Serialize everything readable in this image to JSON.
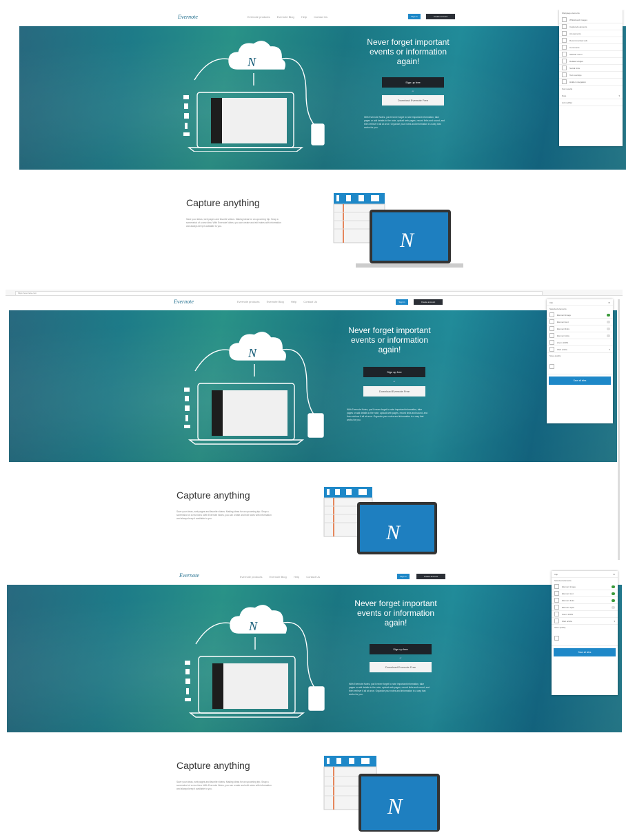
{
  "site": {
    "logo": "Evernote",
    "nav_links": [
      "Evernote products",
      "Evernote Blog",
      "Help",
      "Contact Us"
    ],
    "sign_in": "Sign in",
    "create_account": "Create account"
  },
  "hero": {
    "title": "Never forget important events or information again!",
    "signup_button": "Sign up free",
    "or": "or",
    "download_button": "Download Evernote Free",
    "description": "With Evernote Notes, you’ll never forget to note important information, take pages or add details to the note, upload web pages, record links and sound, and then retrieve it all at once. Organize your notes and information in a way that works for you."
  },
  "capture": {
    "title": "Capture anything",
    "description": "Save your ideas, web pages and favorite videos. Making ideas for an upcoming trip. Snap a screenshot of a new idea. With Evernote Notes, you can create and edit notes with information and always keep it available to you."
  },
  "browser": {
    "url": "https://evernote.com"
  },
  "panel1": {
    "header": "Webpage elements",
    "items": [
      "Whiteboard images",
      "Captured elements",
      "Ad elements",
      "Recommended ads",
      "Comments",
      "Sidebar menu",
      "Related widget",
      "Social links",
      "Text overlays",
      "Hidden navigation"
    ],
    "select_label": "Sort results",
    "select_value": "Date",
    "footer": "Ad modifier"
  },
  "panel2": {
    "header": "Clip",
    "section": "Selected elements",
    "items": [
      "Element image",
      "Element text",
      "Element links",
      "Element style"
    ],
    "zoom_label": "Zoom 100%",
    "select_value": "Web article",
    "quality_label": "Save quality",
    "action": "Save all sites"
  },
  "panel3": {
    "header": "Clip",
    "section": "Selected elements",
    "items": [
      "Element image",
      "Element text",
      "Element links",
      "Element style"
    ],
    "zoom_label": "Zoom 100%",
    "select_value": "Web article",
    "quality_label": "Save quality",
    "action": "Save all sites"
  },
  "colors": {
    "accent": "#1e88c8",
    "dark_button": "#1d2329",
    "hero_teal": "#1f8290",
    "toggle_on": "#3a9a3a"
  },
  "icons": [
    "cloud-icon",
    "laptop-icon",
    "phone-icon",
    "image-icon",
    "paperclip-icon",
    "document-icon",
    "microphone-icon",
    "video-icon",
    "toggle-icon"
  ]
}
